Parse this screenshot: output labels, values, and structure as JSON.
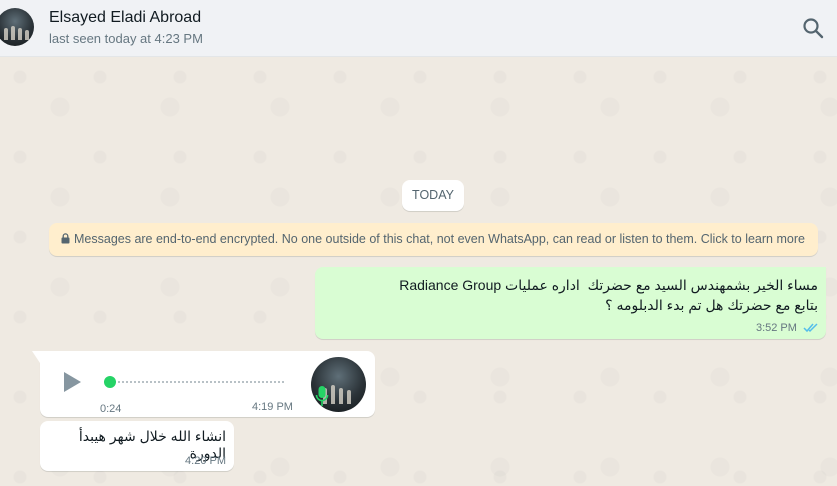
{
  "header": {
    "contact_name": "Elsayed Eladi Abroad",
    "status": "last seen today at 4:23 PM"
  },
  "chat": {
    "date_chip": "TODAY",
    "encryption_notice": "Messages are end-to-end encrypted. No one outside of this chat, not even WhatsApp, can read or listen to them. Click to learn more",
    "messages": [
      {
        "direction": "outgoing",
        "text": "مساء الخير بشمهندس السيد مع حضرتك  اداره عمليات Radiance Group\nبتابع مع حضرتك هل تم بدء الدبلومه ؟",
        "time": "3:52 PM",
        "status": "read"
      },
      {
        "direction": "incoming",
        "type": "voice",
        "duration": "0:24",
        "time": "4:19 PM",
        "progress": 0
      },
      {
        "direction": "incoming",
        "text": "انشاء الله خلال شهر هيبدأ الدورة",
        "time": "4:20 PM"
      }
    ]
  },
  "colors": {
    "outgoing_bubble": "#d9fdd3",
    "incoming_bubble": "#ffffff",
    "chat_background": "#efeae2",
    "read_ticks": "#53bdeb",
    "voice_accent": "#25d366",
    "notice_background": "#ffeecd"
  },
  "icons": [
    "search-icon",
    "lock-icon",
    "double-check-icon",
    "play-icon",
    "mic-icon"
  ]
}
